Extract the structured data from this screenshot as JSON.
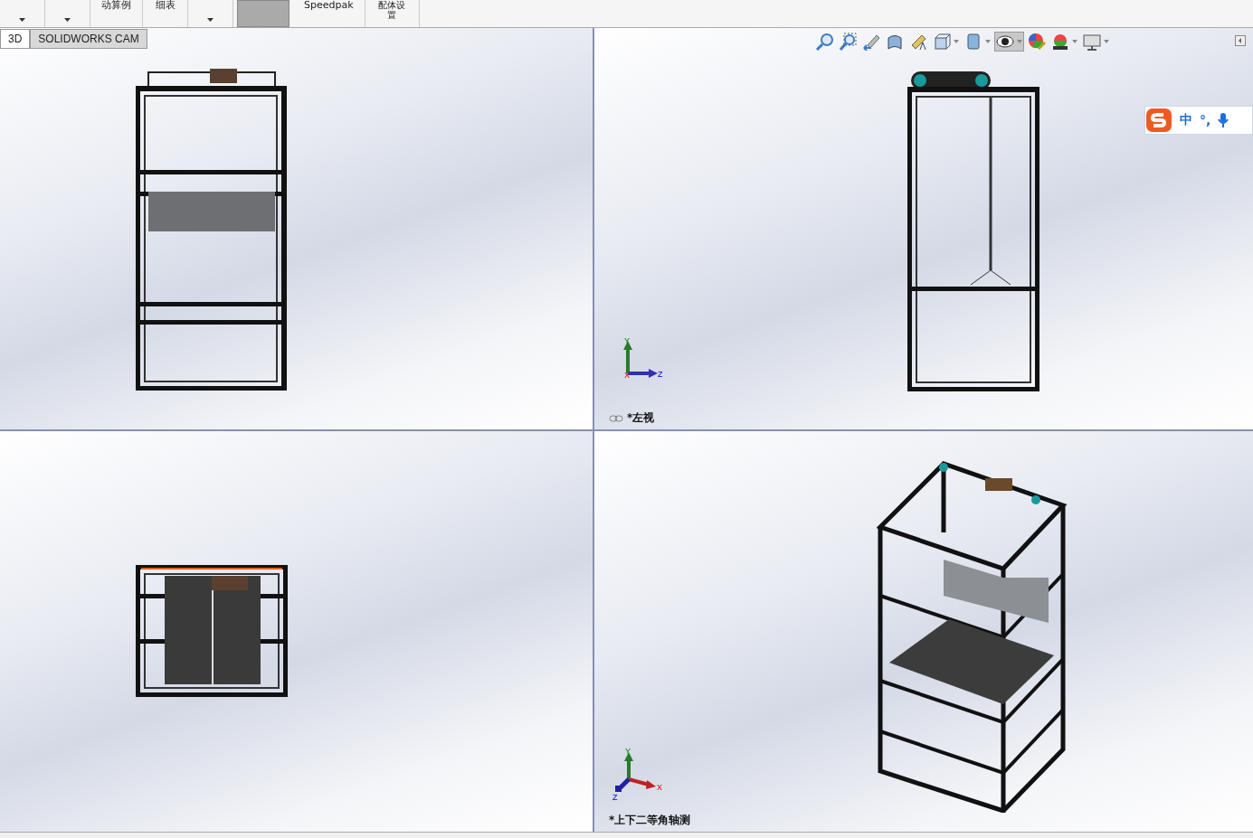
{
  "ribbon": {
    "items": [
      {
        "dropdown": true,
        "selected": false
      },
      {
        "dropdown": true,
        "selected": false
      },
      {
        "label": "动算例",
        "dropdown": false,
        "selected": false
      },
      {
        "label": "细表",
        "dropdown": false,
        "selected": false
      },
      {
        "dropdown": true,
        "selected": false
      },
      {
        "dropdown": false,
        "selected": true
      },
      {
        "label": "Speedpak",
        "dropdown": false,
        "selected": false
      },
      {
        "label": "配体设置",
        "dropdown": false,
        "selected": false
      }
    ]
  },
  "tabs": [
    {
      "label": "3D",
      "selected": true
    },
    {
      "label": "SOLIDWORKS CAM",
      "selected": false
    }
  ],
  "heads_up_toolbar": [
    {
      "kind": "zoom-fit",
      "dropdown": false,
      "selected": false
    },
    {
      "kind": "zoom-area",
      "dropdown": false,
      "selected": false
    },
    {
      "kind": "previous",
      "dropdown": false,
      "selected": false
    },
    {
      "kind": "section",
      "dropdown": false,
      "selected": false
    },
    {
      "kind": "annotation",
      "dropdown": false,
      "selected": false
    },
    {
      "kind": "orientation",
      "dropdown": true,
      "selected": false
    },
    {
      "kind": "display-style",
      "dropdown": true,
      "selected": false
    },
    {
      "kind": "hide-show",
      "dropdown": true,
      "selected": true
    },
    {
      "kind": "appearance",
      "dropdown": false,
      "selected": false
    },
    {
      "kind": "scene",
      "dropdown": true,
      "selected": false
    },
    {
      "kind": "display",
      "dropdown": true,
      "selected": false
    }
  ],
  "ime_bar": {
    "mode": "中",
    "punct": "°,"
  },
  "viewports": [
    {
      "kind": "front"
    },
    {
      "kind": "left",
      "linked": true,
      "label": "*左视",
      "triad": {
        "kind": "side",
        "axes": [
          "Y",
          "X",
          "Z"
        ]
      }
    },
    {
      "kind": "top"
    },
    {
      "kind": "iso",
      "linked": false,
      "label": "*上下二等角轴测",
      "triad": {
        "kind": "iso",
        "axes": [
          "Y",
          "X",
          "Z"
        ]
      }
    }
  ]
}
